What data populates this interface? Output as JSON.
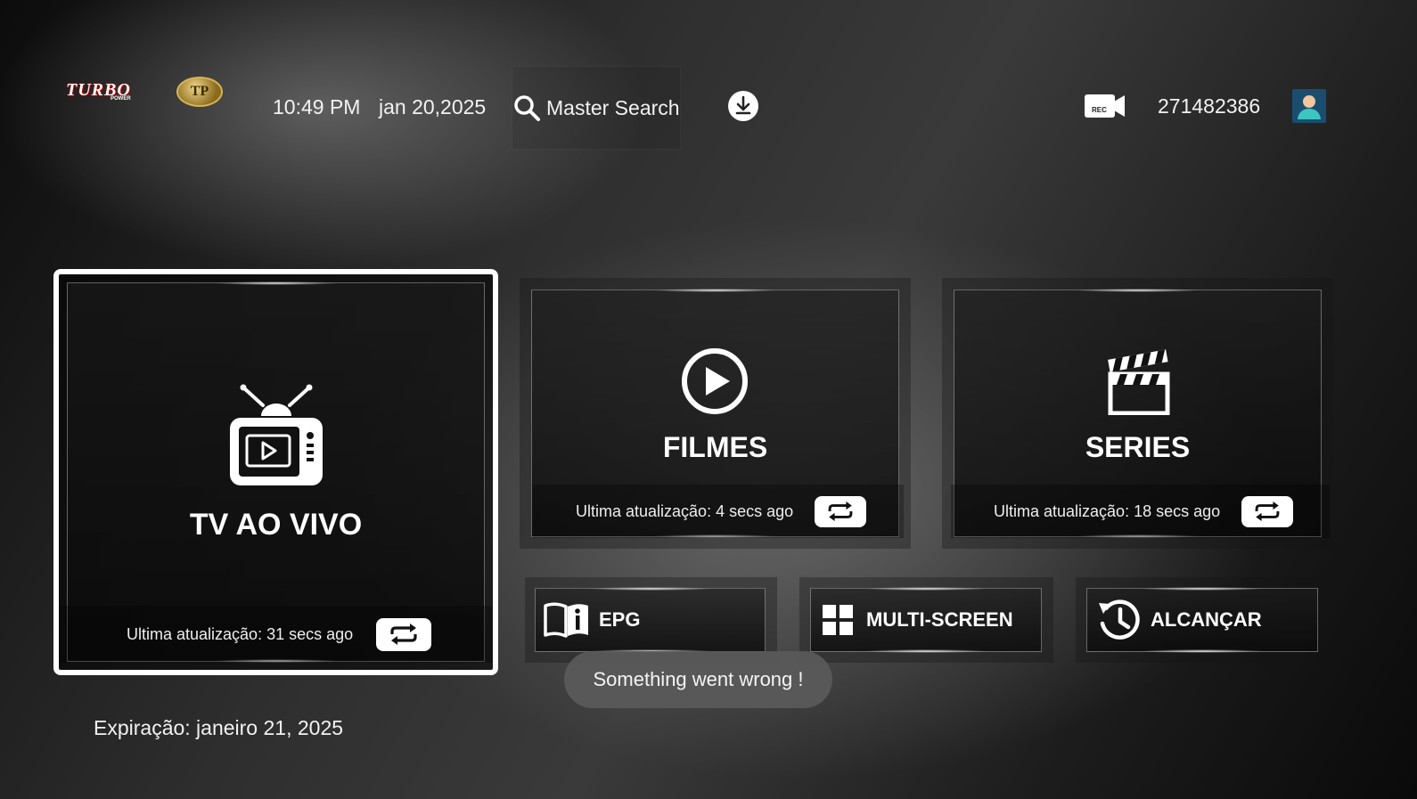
{
  "header": {
    "logo_text": "TURBO",
    "logo_sub": "POWER",
    "logo_badge": "TP",
    "time": "10:49 PM",
    "date": "jan 20,2025",
    "search_label": "Master Search",
    "user_id": "271482386",
    "rec_label": "REC"
  },
  "tiles": {
    "live": {
      "title": "TV AO VIVO",
      "update": "Ultima atualização: 31 secs ago"
    },
    "movies": {
      "title": "FILMES",
      "update": "Ultima atualização: 4 secs ago"
    },
    "series": {
      "title": "SERIES",
      "update": "Ultima atualização: 18 secs ago"
    }
  },
  "buttons": {
    "epg": "EPG",
    "multiscreen": "MULTI-SCREEN",
    "catchup": "ALCANÇAR"
  },
  "toast": "Something went wrong !",
  "expiry": "Expiração: janeiro 21, 2025",
  "icons": {
    "search": "search-icon",
    "download": "download-icon",
    "record": "record-camera-icon",
    "avatar": "user-avatar-icon",
    "live": "tv-icon",
    "movies": "play-circle-icon",
    "series": "clapperboard-icon",
    "refresh": "refresh-icon",
    "epg": "book-info-icon",
    "multiscreen": "grid-icon",
    "catchup": "history-icon"
  }
}
